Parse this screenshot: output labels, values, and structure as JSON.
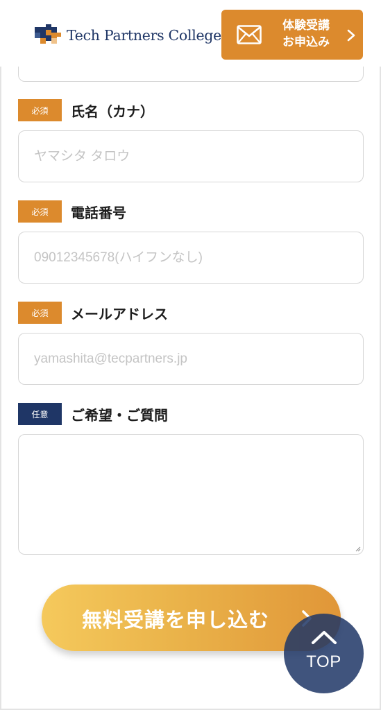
{
  "header": {
    "logo_text": "Tech Partners College",
    "cta": {
      "line1": "体験受講",
      "line2": "お申込み",
      "icon": "mail-icon",
      "arrow_icon": "chevron-right-icon"
    }
  },
  "colors": {
    "accent": "#dc8a2d",
    "navy": "#1f3666",
    "border": "#d6d6d6",
    "placeholder": "#c4c4c4"
  },
  "form": {
    "kana": {
      "badge": "必須",
      "label": "氏名（カナ）",
      "placeholder": "ヤマシタ タロウ",
      "value": ""
    },
    "phone": {
      "badge": "必須",
      "label": "電話番号",
      "placeholder": "09012345678(ハイフンなし)",
      "value": ""
    },
    "email": {
      "badge": "必須",
      "label": "メールアドレス",
      "placeholder": "yamashita@tecpartners.jp",
      "value": ""
    },
    "message": {
      "badge": "任意",
      "label": "ご希望・ご質問",
      "value": ""
    },
    "submit_label": "無料受講を申し込む"
  },
  "back_to_top": {
    "label": "TOP",
    "icon": "chevron-up-icon"
  }
}
